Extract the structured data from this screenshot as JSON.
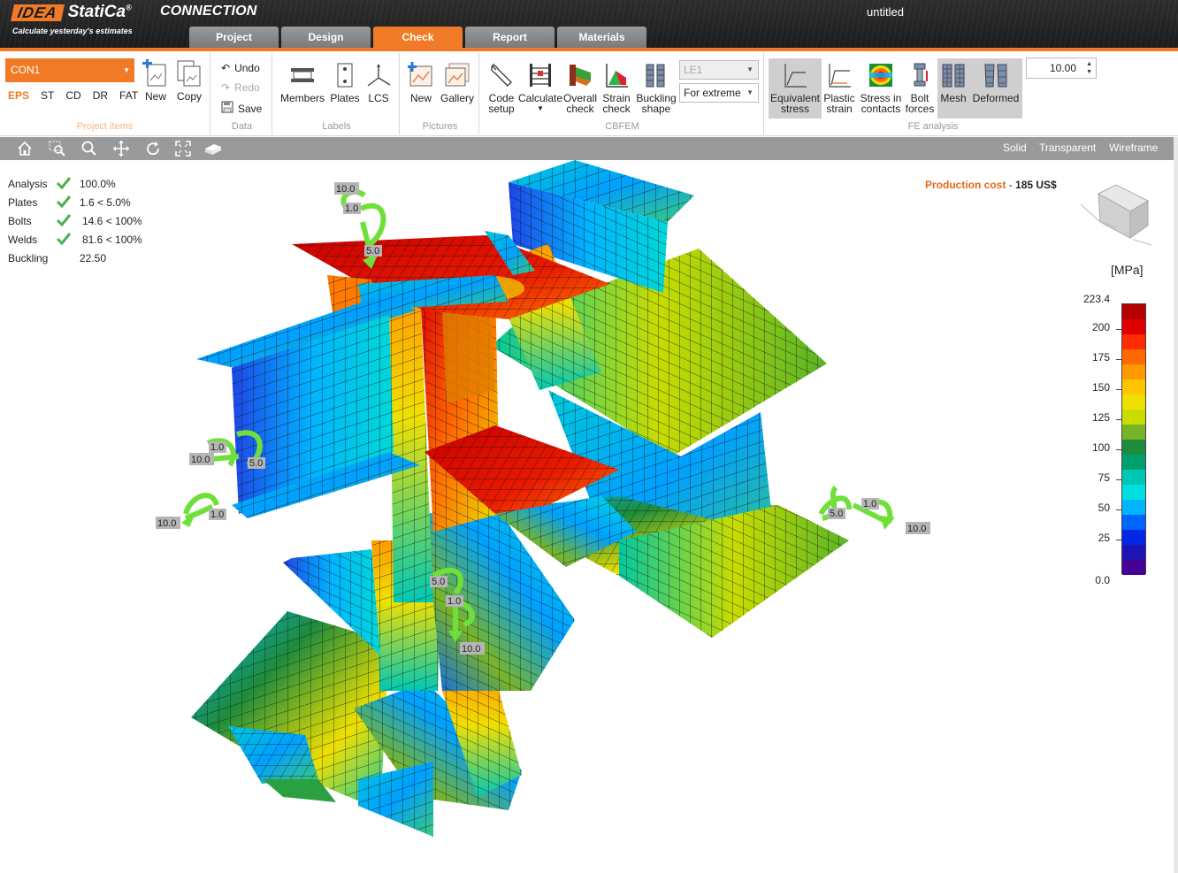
{
  "app": {
    "brand": "IDEA",
    "brand_name": "StatiCa",
    "brand_reg": "®",
    "product": "CONNECTION",
    "tagline": "Calculate yesterday's estimates",
    "document_title": "untitled",
    "accent_color": "#f07a25"
  },
  "tabs": [
    {
      "label": "Project",
      "active": false
    },
    {
      "label": "Design",
      "active": false
    },
    {
      "label": "Check",
      "active": true
    },
    {
      "label": "Report",
      "active": false
    },
    {
      "label": "Materials",
      "active": false
    }
  ],
  "ribbon": {
    "project_items": {
      "selected_connection": "CON1",
      "modes": [
        "EPS",
        "ST",
        "CD",
        "DR",
        "FAT"
      ],
      "active_mode": "EPS",
      "new_label": "New",
      "copy_label": "Copy",
      "group_label": "Project items"
    },
    "data": {
      "undo_label": "Undo",
      "redo_label": "Redo",
      "save_label": "Save",
      "group_label": "Data"
    },
    "labels": {
      "members_label": "Members",
      "plates_label": "Plates",
      "lcs_label": "LCS",
      "group_label": "Labels"
    },
    "pictures": {
      "new_label": "New",
      "gallery_label": "Gallery",
      "group_label": "Pictures"
    },
    "cbfem": {
      "code_setup_label_1": "Code",
      "code_setup_label_2": "setup",
      "calculate_label": "Calculate",
      "overall_check_label_1": "Overall",
      "overall_check_label_2": "check",
      "strain_check_label_1": "Strain",
      "strain_check_label_2": "check",
      "buckling_shape_label_1": "Buckling",
      "buckling_shape_label_2": "shape",
      "load_effect_value": "LE1",
      "extreme_value": "For extreme",
      "group_label": "CBFEM"
    },
    "fe_analysis": {
      "equivalent_stress_label_1": "Equivalent",
      "equivalent_stress_label_2": "stress",
      "plastic_strain_label_1": "Plastic",
      "plastic_strain_label_2": "strain",
      "stress_contacts_label_1": "Stress in",
      "stress_contacts_label_2": "contacts",
      "bolt_forces_label_1": "Bolt",
      "bolt_forces_label_2": "forces",
      "mesh_label": "Mesh",
      "deformed_label": "Deformed",
      "scale_value": "10.00",
      "group_label": "FE analysis"
    }
  },
  "view_toolbar": {
    "icons": [
      "home-icon",
      "zoom-window-icon",
      "zoom-icon",
      "pan-icon",
      "rotate-icon",
      "zoom-extents-icon",
      "section-icon"
    ],
    "modes": [
      "Solid",
      "Transparent",
      "Wireframe"
    ]
  },
  "results": [
    {
      "label": "Analysis",
      "ok": true,
      "value": "100.0%"
    },
    {
      "label": "Plates",
      "ok": true,
      "value": "1.6 < 5.0%"
    },
    {
      "label": "Bolts",
      "ok": true,
      "value": "14.6 < 100%"
    },
    {
      "label": "Welds",
      "ok": true,
      "value": "81.6 < 100%"
    },
    {
      "label": "Buckling",
      "ok": false,
      "value": "22.50"
    }
  ],
  "production_cost": {
    "label": "Production cost",
    "separator": "-",
    "value": "185 US$"
  },
  "legend": {
    "unit": "[MPa]",
    "max": "223.4",
    "ticks": [
      "200",
      "175",
      "150",
      "125",
      "100",
      "75",
      "50",
      "25",
      "0.0"
    ],
    "colors": [
      "#b40000",
      "#e00000",
      "#ff2a00",
      "#ff6a00",
      "#ff9a00",
      "#ffc400",
      "#f0e000",
      "#c8dc00",
      "#78b428",
      "#1e8c3c",
      "#00a06e",
      "#00c8b4",
      "#00e0e0",
      "#00b4ff",
      "#0064ff",
      "#0028e6",
      "#1e14b4",
      "#460096"
    ]
  },
  "load_labels": [
    "10.0",
    "1.0",
    "5.0",
    "10.0",
    "1.0",
    "5.0",
    "10.0",
    "1.0",
    "5.0",
    "1.0",
    "10.0",
    "5.0",
    "1.0",
    "10.0"
  ]
}
